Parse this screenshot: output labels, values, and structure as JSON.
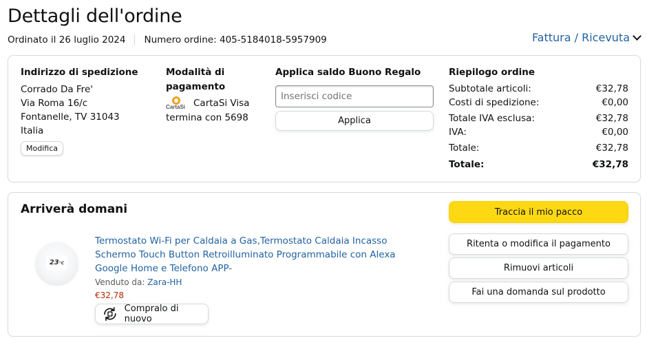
{
  "header": {
    "title": "Dettagli dell'ordine",
    "order_date": "Ordinato il 26 luglio 2024",
    "order_number": "Numero ordine: 405-5184018-5957909",
    "invoice_label": "Fattura / Ricevuta"
  },
  "shipping": {
    "title": "Indirizzo di spedizione",
    "lines": [
      "Corrado Da Fre'",
      "Via Roma 16/c",
      "Fontanelle, TV 31043",
      "Italia"
    ],
    "edit_label": "Modifica"
  },
  "payment": {
    "title_line1": "Modalità di",
    "title_line2": "pagamento",
    "logo_text": "CartaSi",
    "card": "CartaSi Visa",
    "ending": "termina con 5698"
  },
  "gift": {
    "title": "Applica saldo Buono Regalo",
    "placeholder": "Inserisci codice",
    "apply_label": "Applica"
  },
  "summary": {
    "title": "Riepilogo ordine",
    "rows": [
      {
        "label": "Subtotale articoli:",
        "value": "€32,78"
      },
      {
        "label": "Costi di spedizione:",
        "value": "€0,00"
      },
      {
        "label": "Totale IVA esclusa:",
        "value": "€32,78"
      },
      {
        "label": "IVA:",
        "value": "€0,00"
      },
      {
        "label": "Totale:",
        "value": "€32,78"
      },
      {
        "label": "Totale:",
        "value": "€32,78"
      }
    ]
  },
  "shipment": {
    "status": "Arriverà domani",
    "track_label": "Traccia il mio pacco",
    "retry_payment_label": "Ritenta o modifica il pagamento",
    "remove_label": "Rimuovi articoli",
    "ask_label": "Fai una domanda sul prodotto"
  },
  "product": {
    "title": "Termostato Wi-Fi per Caldaia a Gas,Termostato Caldaia Incasso Schermo Touch Button Retroilluminato Programmabile con Alexa Google Home e Telefono APP-",
    "sold_by_label": "Venduto da:",
    "seller": "Zara-HH",
    "price": "€32,78",
    "buy_again_label": "Compralo di nuovo",
    "screen_temp": "23",
    "screen_unit": "°C"
  },
  "colors": {
    "link": "#2162a1",
    "price": "#b12704",
    "primary_button": "#ffd814",
    "border": "#d5d9d9"
  },
  "icons": [
    "chevron-down-icon",
    "cartasi-logo",
    "buy-again-icon"
  ]
}
